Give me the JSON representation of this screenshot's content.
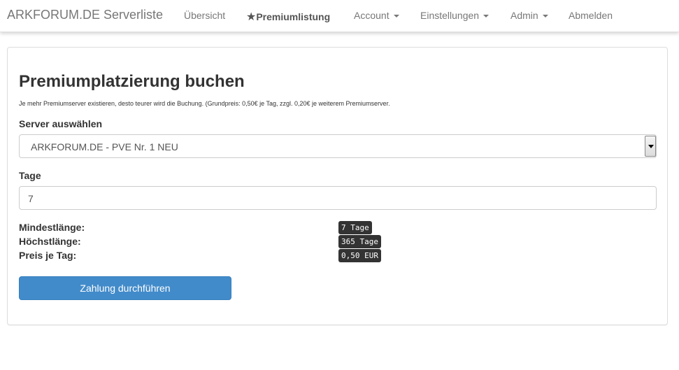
{
  "navbar": {
    "brand": "ARKFORUM.DE Serverliste",
    "items": [
      {
        "label": "Übersicht"
      },
      {
        "label": "Premiumlistung",
        "star": "★"
      },
      {
        "label": "Account"
      },
      {
        "label": "Einstellungen"
      },
      {
        "label": "Admin"
      },
      {
        "label": "Abmelden"
      }
    ]
  },
  "form": {
    "title": "Premiumplatzierung buchen",
    "hint": "Je mehr Premiumserver existieren, desto teurer wird die Buchung. (Grundpreis: 0,50€ je Tag, zzgl. 0,20€ je weiterem Premiumserver.",
    "server_label": "Server auswählen",
    "server_selected": "ARKFORUM.DE - PVE Nr. 1 NEU",
    "days_label": "Tage",
    "days_value": "7",
    "stats": [
      {
        "label": "Mindestlänge:",
        "value": "7 Tage"
      },
      {
        "label": "Höchstlänge:",
        "value": "365 Tage"
      },
      {
        "label": "Preis je Tag:",
        "value": "0,50 EUR"
      }
    ],
    "submit_label": "Zahlung durchführen"
  },
  "colors": {
    "primary_button": "#428bca",
    "code_badge": "#333333"
  }
}
